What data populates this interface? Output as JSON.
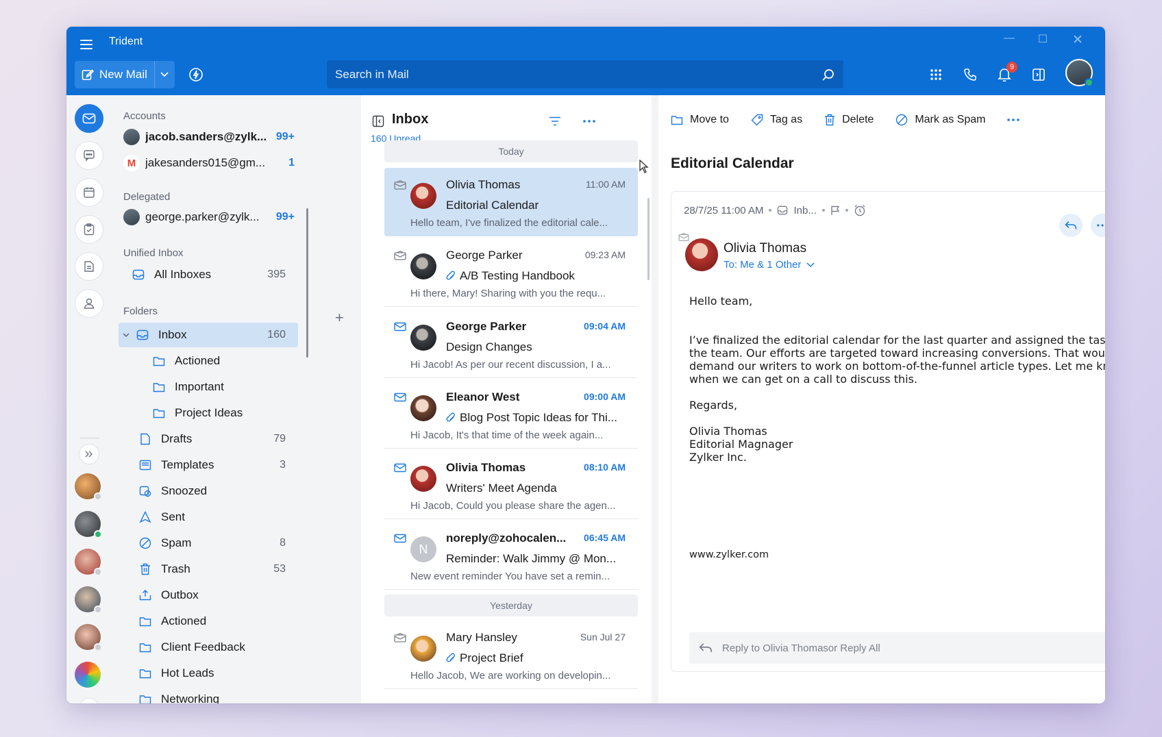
{
  "app": {
    "title": "Trident",
    "new_mail_label": "New Mail",
    "search_placeholder": "Search in Mail",
    "notifications_count": "9",
    "colors": {
      "primary": "#0b6fd6",
      "accent": "#1f7ae0",
      "selected": "#cfe1f5"
    }
  },
  "folders_pane": {
    "accounts_heading": "Accounts",
    "accounts": [
      {
        "email": "jacob.sanders@zylk...",
        "count": "99+"
      },
      {
        "email": "jakesanders015@gm...",
        "count": "1"
      }
    ],
    "delegated_heading": "Delegated",
    "delegated": [
      {
        "email": "george.parker@zylk...",
        "count": "99+"
      }
    ],
    "unified_heading": "Unified Inbox",
    "all_inboxes": {
      "label": "All Inboxes",
      "count": "395"
    },
    "folders_heading": "Folders",
    "folders": [
      {
        "label": "Inbox",
        "count": "160",
        "icon": "inbox-icon"
      },
      {
        "label": "Actioned",
        "count": "",
        "icon": "folder-icon"
      },
      {
        "label": "Important",
        "count": "",
        "icon": "folder-icon"
      },
      {
        "label": "Project Ideas",
        "count": "",
        "icon": "folder-icon"
      },
      {
        "label": "Drafts",
        "count": "79",
        "icon": "drafts-icon"
      },
      {
        "label": "Templates",
        "count": "3",
        "icon": "templates-icon"
      },
      {
        "label": "Snoozed",
        "count": "",
        "icon": "snoozed-icon"
      },
      {
        "label": "Sent",
        "count": "",
        "icon": "sent-icon"
      },
      {
        "label": "Spam",
        "count": "8",
        "icon": "spam-icon"
      },
      {
        "label": "Trash",
        "count": "53",
        "icon": "trash-icon"
      },
      {
        "label": "Outbox",
        "count": "",
        "icon": "outbox-icon"
      },
      {
        "label": "Actioned",
        "count": "",
        "icon": "folder-icon"
      },
      {
        "label": "Client Feedback",
        "count": "",
        "icon": "folder-icon"
      },
      {
        "label": "Hot Leads",
        "count": "",
        "icon": "folder-icon"
      },
      {
        "label": "Networking",
        "count": "",
        "icon": "folder-icon"
      }
    ]
  },
  "message_list": {
    "title": "Inbox",
    "unread_label": "160 Unread",
    "today_label": "Today",
    "yesterday_label": "Yesterday",
    "messages": [
      {
        "sender": "Olivia Thomas",
        "time": "11:00 AM",
        "subject": "Editorial Calendar",
        "preview": "Hello team, I've finalized the editorial cale...",
        "unread": false,
        "attachment": false
      },
      {
        "sender": "George Parker",
        "time": "09:23 AM",
        "subject": "A/B Testing Handbook",
        "preview": "Hi there, Mary! Sharing with you the requ...",
        "unread": false,
        "attachment": true
      },
      {
        "sender": "George Parker",
        "time": "09:04 AM",
        "subject": "Design Changes",
        "preview": "Hi Jacob! As per our recent discussion, I a...",
        "unread": true,
        "attachment": false
      },
      {
        "sender": "Eleanor West",
        "time": "09:00 AM",
        "subject": "Blog Post Topic Ideas for Thi...",
        "preview": "Hi Jacob, It's that time of the week again...",
        "unread": true,
        "attachment": true
      },
      {
        "sender": "Olivia Thomas",
        "time": "08:10 AM",
        "subject": "Writers' Meet Agenda",
        "preview": "Hi Jacob, Could you please share the agen...",
        "unread": true,
        "attachment": false
      },
      {
        "sender": "noreply@zohocalen...",
        "time": "06:45 AM",
        "subject": "Reminder: Walk Jimmy @ Mon...",
        "preview": "New event reminder You have set a remin...",
        "unread": true,
        "attachment": false,
        "avatar_letter": "N"
      },
      {
        "sender": "Mary Hansley",
        "time": "Sun Jul 27",
        "subject": "Project Brief",
        "preview": "Hello Jacob, We are working on developin...",
        "unread": false,
        "attachment": true
      }
    ]
  },
  "reader": {
    "toolbar": {
      "move_to": "Move to",
      "tag_as": "Tag as",
      "delete": "Delete",
      "mark_spam": "Mark as Spam"
    },
    "subject": "Editorial Calendar",
    "date": "28/7/25 11:00 AM",
    "folder": "Inb...",
    "sender": "Olivia Thomas",
    "to": "To: Me & 1 Other",
    "body": {
      "greeting": "Hello team,",
      "paragraph": "I’ve finalized the editorial calendar for the last quarter and assigned the tasks to the team. Our efforts are targeted toward increasing conversions. That would demand our writers to work on bottom-of-the-funnel article types. Let me know when we can get on a call to discuss this.",
      "regards": "Regards,",
      "sig_name": "Olivia Thomas",
      "sig_title": "Editorial Magnager",
      "sig_company": "Zylker Inc.",
      "website": "www.zylker.com"
    },
    "reply_placeholder": "Reply to Olivia Thomasor Reply All"
  }
}
